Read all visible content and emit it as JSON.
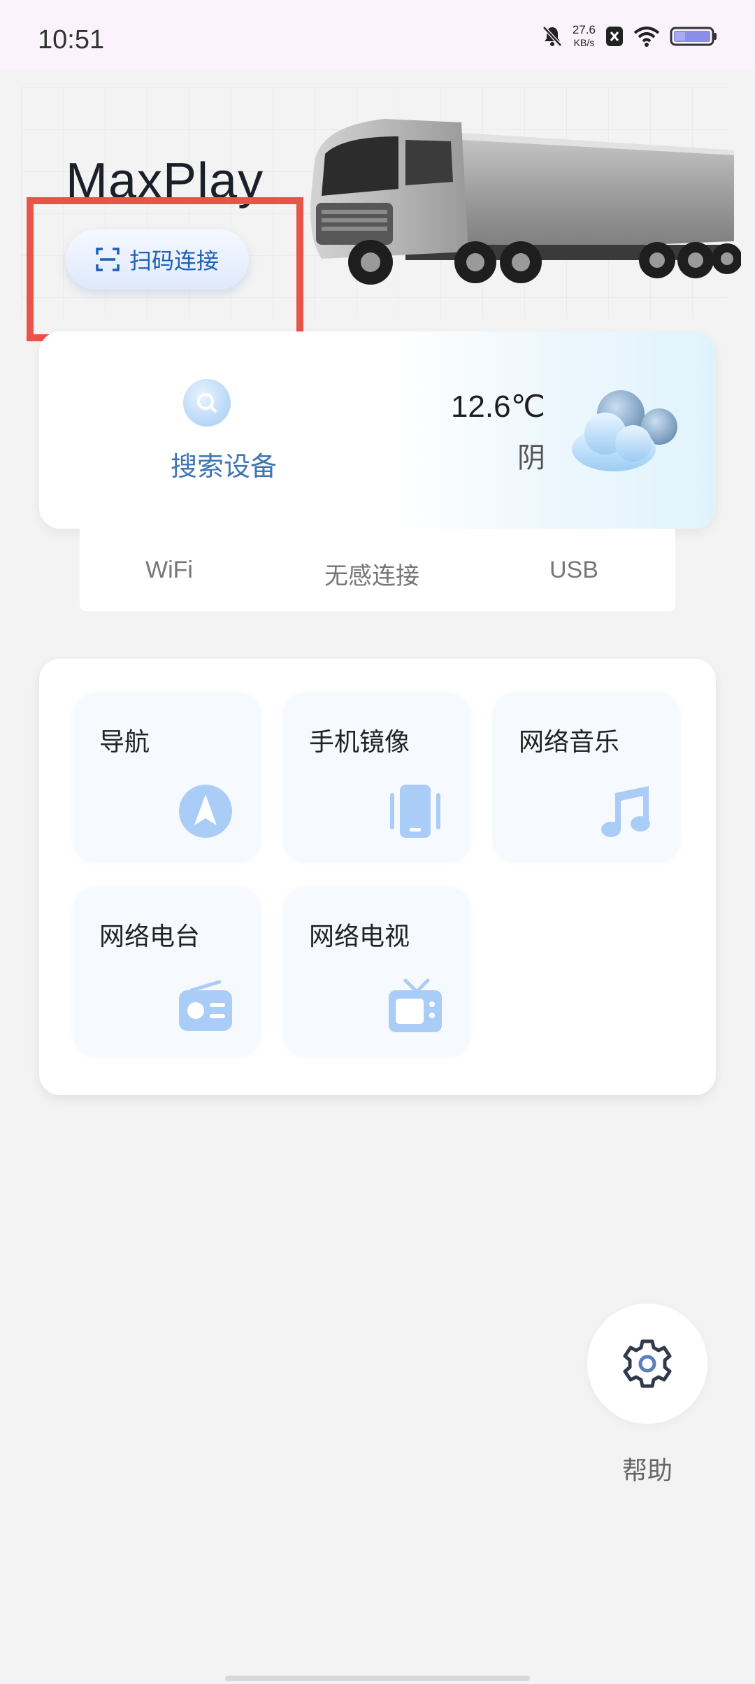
{
  "status_bar": {
    "time": "10:51",
    "net_speed_value": "27.6",
    "net_speed_unit": "KB/s",
    "icons": [
      "bell-off-icon",
      "close-badge-icon",
      "wifi-icon",
      "battery-icon"
    ]
  },
  "header": {
    "brand": "MaxPlay",
    "scan_button_label": "扫码连接"
  },
  "device_card": {
    "search_label": "搜索设备",
    "temperature": "12.6℃",
    "weather": "阴"
  },
  "connection_tabs": [
    "WiFi",
    "无感连接",
    "USB"
  ],
  "features": [
    {
      "label": "导航",
      "icon": "navigation-icon"
    },
    {
      "label": "手机镜像",
      "icon": "phone-mirror-icon"
    },
    {
      "label": "网络音乐",
      "icon": "music-note-icon"
    },
    {
      "label": "网络电台",
      "icon": "radio-icon"
    },
    {
      "label": "网络电视",
      "icon": "tv-icon"
    }
  ],
  "help": {
    "label": "帮助",
    "icon": "gear-icon"
  },
  "colors": {
    "accent_blue": "#1e5fb8",
    "icon_blue": "#a9cdf6",
    "highlight_red": "#e8534a"
  }
}
